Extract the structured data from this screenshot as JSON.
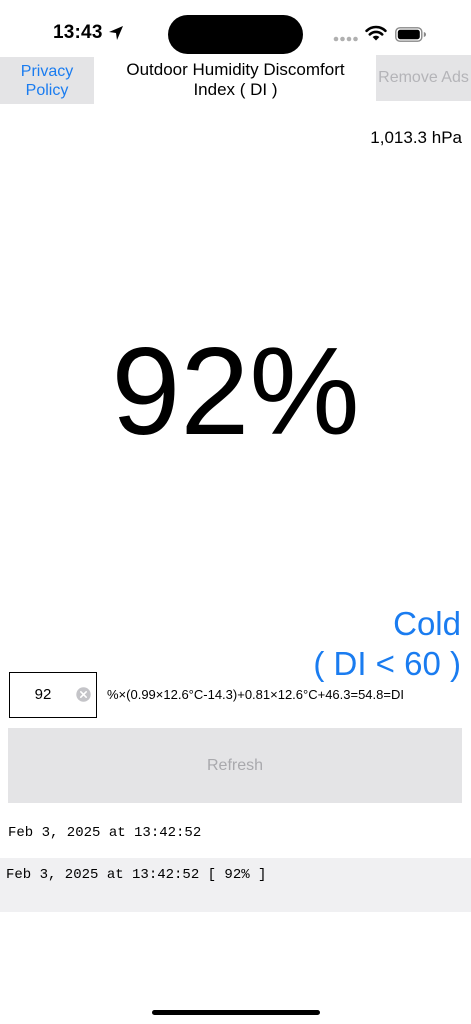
{
  "status_bar": {
    "time": "13:43",
    "icons": [
      "location-arrow-icon",
      "signal-dots-icon",
      "wifi-icon",
      "battery-icon"
    ]
  },
  "header": {
    "privacy_label": "Privacy Policy",
    "title": "Outdoor Humidity Discomfort Index ( DI )",
    "remove_ads_label": "Remove Ads"
  },
  "pressure": "1,013.3 hPa",
  "humidity_display": "92%",
  "comfort": {
    "label_line1": "Cold",
    "label_line2": "( DI < 60 )",
    "color": "#1a7cf0"
  },
  "humidity_input": {
    "value": "92",
    "clear_icon": "clear-circle-icon"
  },
  "formula": "%×(0.99×12.6°C-14.3)+0.81×12.6°C+46.3=54.8=DI",
  "refresh_label": "Refresh",
  "last_updated": "Feb 3, 2025 at 13:42:52",
  "history": [
    "Feb 3, 2025 at 13:42:52 [ 92% ]"
  ],
  "colors": {
    "accent": "#1a7cf0",
    "button_bg": "#e4e4e6",
    "disabled_text": "#b4b4b8",
    "history_bg": "#f0f0f2"
  }
}
